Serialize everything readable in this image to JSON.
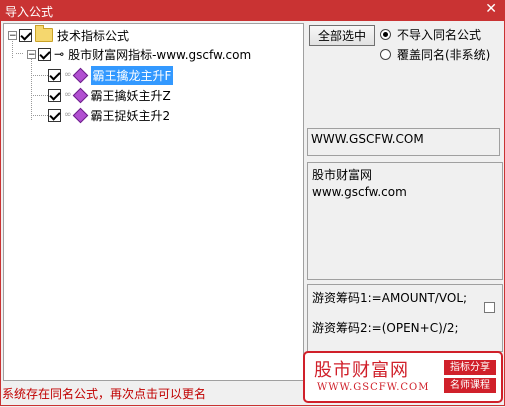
{
  "window": {
    "title": "导入公式",
    "close_symbol": "✕"
  },
  "tree": {
    "root": {
      "label": "技术指标公式",
      "checked": true,
      "expander": "−"
    },
    "group": {
      "label": "股市财富网指标-www.gscfw.com",
      "checked": true,
      "expander": "−"
    },
    "items": [
      {
        "label": "霸王擒龙主升F",
        "checked": true,
        "selected": true
      },
      {
        "label": "霸王擒妖主升Z",
        "checked": true,
        "selected": false
      },
      {
        "label": "霸王捉妖主升2",
        "checked": true,
        "selected": false
      }
    ]
  },
  "controls": {
    "select_all_label": "全部选中",
    "radio_options": [
      {
        "label": "不导入同名公式",
        "selected": true
      },
      {
        "label": "覆盖同名(非系统)",
        "selected": false
      }
    ]
  },
  "info": {
    "url": "WWW.GSCFW.COM",
    "description_line1": "股市财富网",
    "description_line2": "www.gscfw.com",
    "formula_line1": "游资筹码1:=AMOUNT/VOL;",
    "formula_line2": "游资筹码2:=(OPEN+C)/2;"
  },
  "status": {
    "message": "系统存在同名公式，再次点击可以更名",
    "color": "#c00000"
  },
  "banner": {
    "brand": "股市财富网",
    "website": "WWW.GSCFW.COM",
    "tag1": "指标分享",
    "tag2": "名师课程",
    "color": "#d0202a"
  },
  "colors": {
    "title_bar": "#c93333",
    "selection": "#3399ff",
    "gem": "#b14fd1"
  }
}
